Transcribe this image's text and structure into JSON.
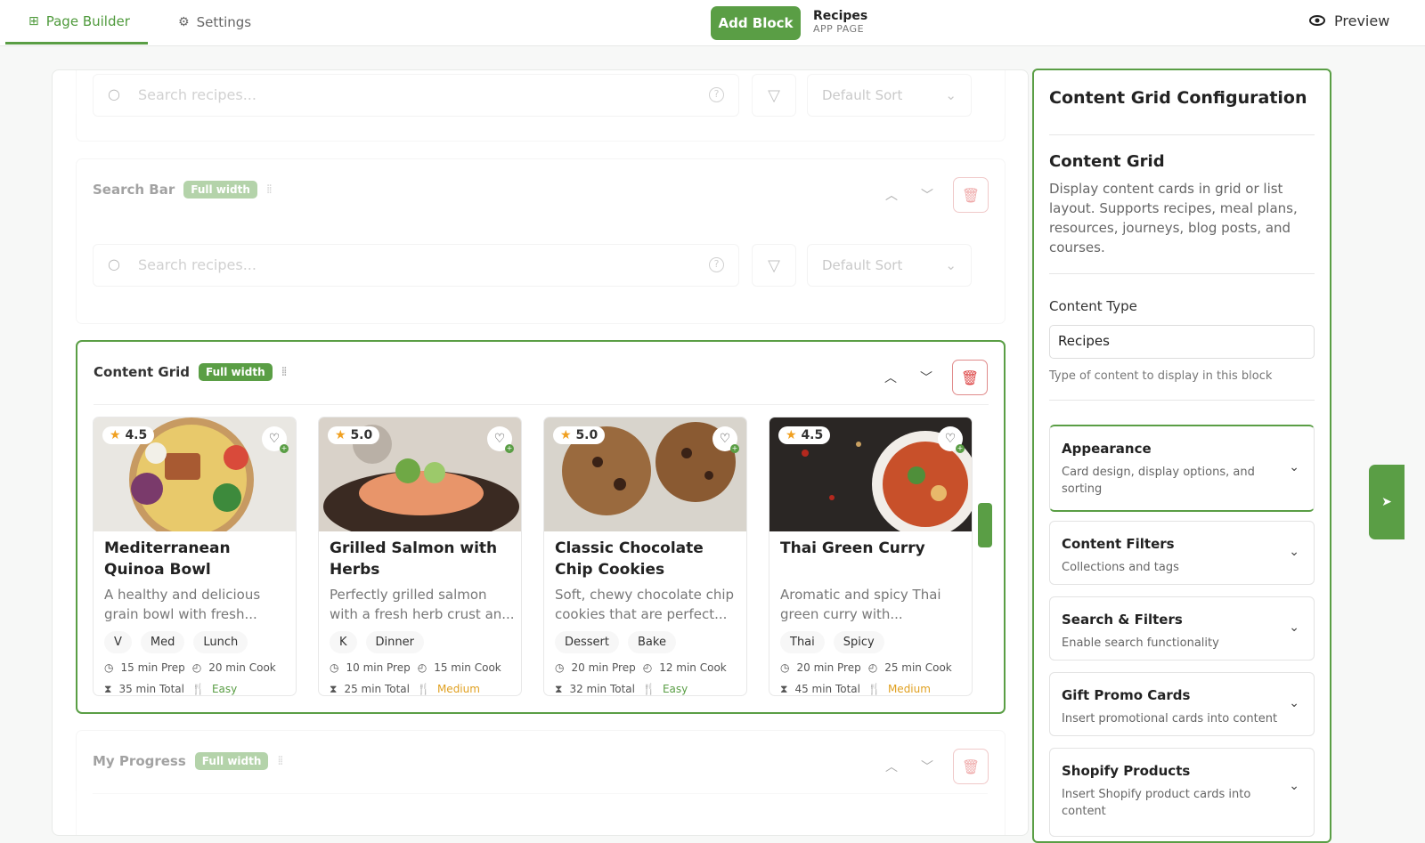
{
  "header": {
    "tabs": [
      {
        "label": "Page Builder",
        "icon": "grid-icon"
      },
      {
        "label": "Settings",
        "icon": "gear-icon"
      }
    ],
    "add_block": "Add Block",
    "page_title": "Recipes",
    "page_subtitle": "APP PAGE",
    "preview": "Preview"
  },
  "blocks": {
    "top_search": {
      "placeholder": "Search recipes...",
      "sort": "Default Sort"
    },
    "search_bar": {
      "name": "Search Bar",
      "badge": "Full width",
      "placeholder": "Search recipes...",
      "sort": "Default Sort"
    },
    "content_grid": {
      "name": "Content Grid",
      "badge": "Full width"
    },
    "my_progress": {
      "name": "My Progress",
      "badge": "Full width"
    }
  },
  "cards": [
    {
      "rating": "4.5",
      "title": "Mediterranean Quinoa Bowl",
      "desc": "A healthy and delicious grain bowl with fresh...",
      "tags": [
        "V",
        "Med",
        "Lunch"
      ],
      "prep": "15 min Prep",
      "cook": "20 min Cook",
      "total": "35 min Total",
      "difficulty": "Easy"
    },
    {
      "rating": "5.0",
      "title": "Grilled Salmon with Herbs",
      "desc": "Perfectly grilled salmon with a fresh herb crust an...",
      "tags": [
        "K",
        "Dinner"
      ],
      "prep": "10 min Prep",
      "cook": "15 min Cook",
      "total": "25 min Total",
      "difficulty": "Medium"
    },
    {
      "rating": "5.0",
      "title": "Classic Chocolate Chip Cookies",
      "desc": "Soft, chewy chocolate chip cookies that are perfect...",
      "tags": [
        "Dessert",
        "Bake"
      ],
      "prep": "20 min Prep",
      "cook": "12 min Cook",
      "total": "32 min Total",
      "difficulty": "Easy"
    },
    {
      "rating": "4.5",
      "title": "Thai Green Curry",
      "desc": "Aromatic and spicy Thai green curry with...",
      "tags": [
        "Thai",
        "Spicy"
      ],
      "prep": "20 min Prep",
      "cook": "25 min Cook",
      "total": "45 min Total",
      "difficulty": "Medium"
    }
  ],
  "panel": {
    "title": "Content Grid Configuration",
    "section_title": "Content Grid",
    "section_desc": "Display content cards in grid or list layout. Supports recipes, meal plans, resources, journeys, blog posts, and courses.",
    "content_type_label": "Content Type",
    "content_type_value": "Recipes",
    "content_type_help": "Type of content to display in this block",
    "accordions": [
      {
        "title": "Appearance",
        "desc": "Card design, display options, and sorting"
      },
      {
        "title": "Content Filters",
        "desc": "Collections and tags"
      },
      {
        "title": "Search & Filters",
        "desc": "Enable search functionality"
      },
      {
        "title": "Gift Promo Cards",
        "desc": "Insert promotional cards into content"
      },
      {
        "title": "Shopify Products",
        "desc": "Insert Shopify product cards into content"
      }
    ]
  },
  "colors": {
    "accent": "#5a9e45",
    "danger": "#d44444",
    "medium": "#e0a020"
  }
}
